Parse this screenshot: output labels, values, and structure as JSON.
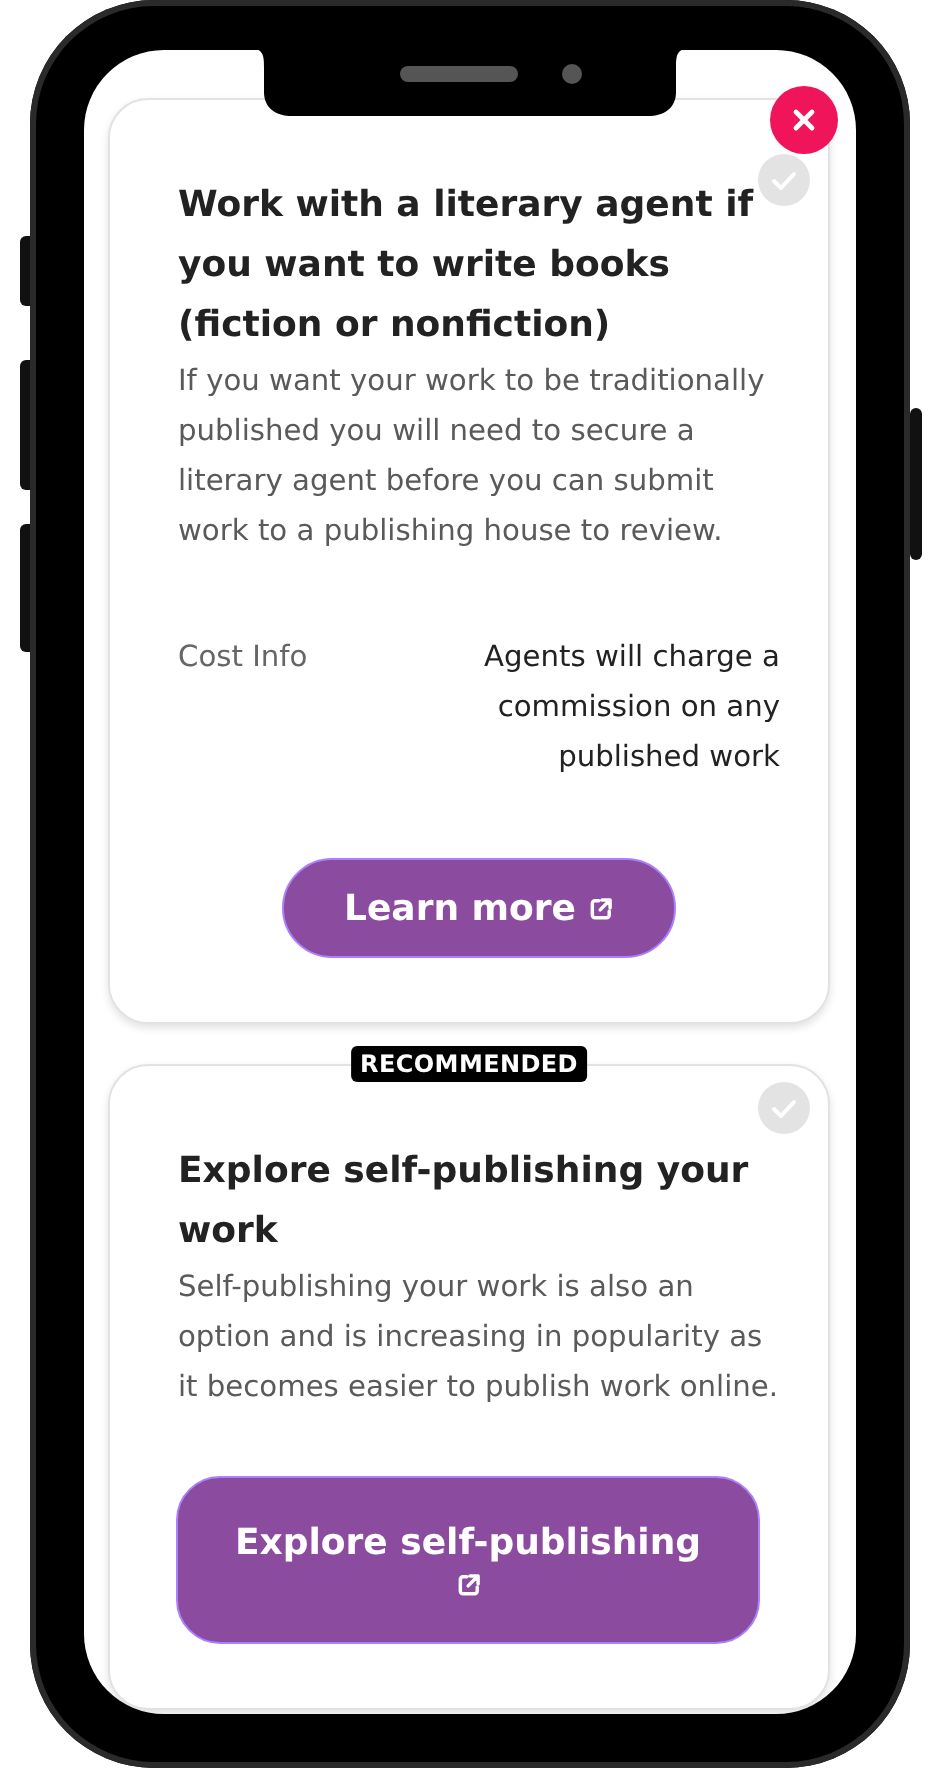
{
  "cards": [
    {
      "title": "Work with a literary agent if you want to write books (fiction or nonfiction)",
      "description": "If you want your work to be traditionally published you will need to secure a literary agent before you can submit work to a publishing house to review.",
      "checked": false,
      "cost": {
        "label": "Cost Info",
        "value": "Agents will charge a commission on any published work"
      },
      "button": {
        "label": "Learn more",
        "kind": "compact"
      }
    },
    {
      "badge": "RECOMMENDED",
      "title": "Explore self-publishing your work",
      "description": "Self-publishing your work is also an option and is increasing in popularity as it becomes easier to publish work online.",
      "checked": false,
      "button": {
        "label": "Explore self-publishing",
        "kind": "wide"
      }
    }
  ]
}
